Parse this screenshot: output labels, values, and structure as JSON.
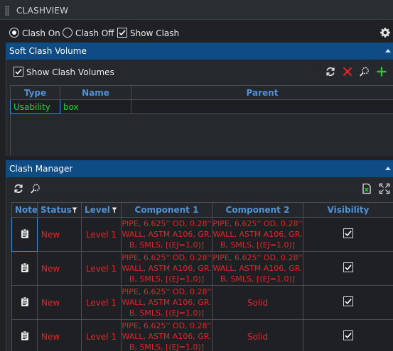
{
  "window": {
    "title": "CLASHVIEW"
  },
  "mode": {
    "clash_on": "Clash On",
    "clash_off": "Clash Off",
    "show_clash": "Show Clash",
    "selected": "clash_on",
    "show_clash_checked": true
  },
  "soft_clash": {
    "header": "Soft Clash Volume",
    "show_volumes_label": "Show Clash Volumes",
    "show_volumes_checked": true,
    "columns": [
      "Type",
      "Name",
      "Parent"
    ],
    "rows": [
      {
        "type": "Usability",
        "name": "box",
        "parent": ""
      }
    ]
  },
  "clash_manager": {
    "header": "Clash Manager",
    "columns": [
      "Note",
      "Status",
      "Level",
      "Component 1",
      "Component 2",
      "Visibility"
    ],
    "rows": [
      {
        "status": "New",
        "level": "Level 1",
        "component1": "PIPE, 6.625'' OD, 0.28'' WALL, ASTM A106, GR. B, SMLS, [(EJ=1.0)]",
        "component2": "PIPE, 6.625'' OD, 0.28'' WALL, ASTM A106, GR. B, SMLS, [(EJ=1.0)]",
        "visible": true
      },
      {
        "status": "New",
        "level": "Level 1",
        "component1": "PIPE, 6.625'' OD, 0.28'' WALL, ASTM A106, GR. B, SMLS, [(EJ=1.0)]",
        "component2": "PIPE, 6.625'' OD, 0.28'' WALL, ASTM A106, GR. B, SMLS, [(EJ=1.0)]",
        "visible": true
      },
      {
        "status": "New",
        "level": "Level 1",
        "component1": "PIPE, 6.625'' OD, 0.28'' WALL, ASTM A106, GR. B, SMLS, [(EJ=1.0)]",
        "component2": "Solid",
        "visible": true
      },
      {
        "status": "New",
        "level": "Level 1",
        "component1": "PIPE, 6.625'' OD, 0.28'' WALL, ASTM A106, GR. B, SMLS, [(EJ=1.0)]",
        "component2": "Solid",
        "visible": true
      }
    ]
  },
  "colors": {
    "accent_header": "#0f4c86",
    "column_header_text": "#4f92d6",
    "type_text": "#21d432",
    "status_text": "#e0262b",
    "add_icon": "#31c43a",
    "delete_icon": "#e0262b"
  },
  "icons": {
    "settings": "gear-icon",
    "refresh": "refresh-icon",
    "delete": "close-icon",
    "zoom": "zoom-icon",
    "add": "plus-icon",
    "export": "excel-export-icon",
    "expand": "expand-icon",
    "note": "clipboard-icon",
    "filter": "filter-icon"
  }
}
